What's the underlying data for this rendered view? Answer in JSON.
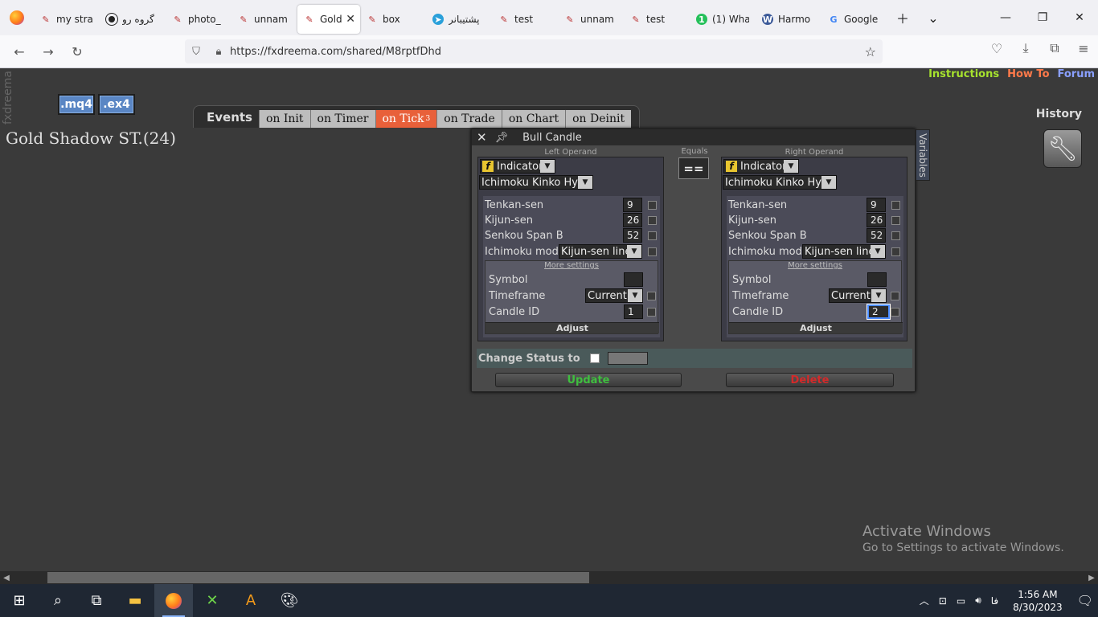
{
  "browser": {
    "tabs": [
      {
        "label": "my stra",
        "icon": "fxdreema-icon"
      },
      {
        "label": "گروه رو",
        "icon": "circle-icon"
      },
      {
        "label": "photo_",
        "icon": "fxdreema-icon"
      },
      {
        "label": "unnam",
        "icon": "fxdreema-icon"
      },
      {
        "label": "Gold",
        "icon": "fxdreema-icon",
        "active": true
      },
      {
        "label": "box",
        "icon": "fxdreema-icon"
      },
      {
        "label": "پشتیبانر",
        "icon": "telegram-icon"
      },
      {
        "label": "test",
        "icon": "fxdreema-icon"
      },
      {
        "label": "unnam",
        "icon": "fxdreema-icon"
      },
      {
        "label": "test",
        "icon": "fxdreema-icon"
      },
      {
        "label": "(1) Wha",
        "icon": "whatsapp-icon"
      },
      {
        "label": "Harmo",
        "icon": "wordpress-icon"
      },
      {
        "label": "Google",
        "icon": "google-icon"
      }
    ],
    "url": "https://fxdreema.com/shared/M8rptfDhd"
  },
  "page": {
    "brand": "fxdreema",
    "mq4": ".mq4",
    "ex4": ".ex4",
    "links": {
      "instructions": "Instructions",
      "howto": "How To",
      "forum": "Forum"
    },
    "history": "History",
    "title": "Gold Shadow ST.(24)",
    "events_label": "Events",
    "event_tabs": [
      "on Init",
      "on Timer",
      "on Tick",
      "on Trade",
      "on Chart",
      "on Deinit"
    ],
    "active_tab_badge": "3"
  },
  "dialog": {
    "title": "Bull Candle",
    "variables": "Variables",
    "equals_caption": "Equals",
    "equals_op": "==",
    "left": {
      "caption": "Left Operand",
      "type": "Indicator",
      "indicator": "Ichimoku Kinko Hyo",
      "tenkan_label": "Tenkan-sen",
      "tenkan": "9",
      "kijun_label": "Kijun-sen",
      "kijun": "26",
      "senkou_label": "Senkou Span B",
      "senkou": "52",
      "mode_label": "Ichimoku mode",
      "mode": "Kijun-sen line",
      "more": "More settings",
      "symbol_label": "Symbol",
      "symbol": "",
      "timeframe_label": "Timeframe",
      "timeframe": "Current",
      "candle_label": "Candle ID",
      "candle": "1",
      "adjust": "Adjust"
    },
    "right": {
      "caption": "Right Operand",
      "type": "Indicator",
      "indicator": "Ichimoku Kinko Hyo",
      "tenkan_label": "Tenkan-sen",
      "tenkan": "9",
      "kijun_label": "Kijun-sen",
      "kijun": "26",
      "senkou_label": "Senkou Span B",
      "senkou": "52",
      "mode_label": "Ichimoku mode",
      "mode": "Kijun-sen line",
      "more": "More settings",
      "symbol_label": "Symbol",
      "symbol": "",
      "timeframe_label": "Timeframe",
      "timeframe": "Current",
      "candle_label": "Candle ID",
      "candle": "2",
      "adjust": "Adjust"
    },
    "status_label": "Change Status to",
    "update": "Update",
    "delete": "Delete"
  },
  "watermark": {
    "line1": "Activate Windows",
    "line2": "Go to Settings to activate Windows."
  },
  "taskbar": {
    "lang": "فا",
    "time": "1:56 AM",
    "date": "8/30/2023"
  },
  "colors": {
    "active_tab": "#e8603a",
    "update": "#3fbf3f",
    "delete": "#d42a2a",
    "instructions": "#a6e22e",
    "howto": "#ff7a4a",
    "forum": "#8aa0ff"
  }
}
